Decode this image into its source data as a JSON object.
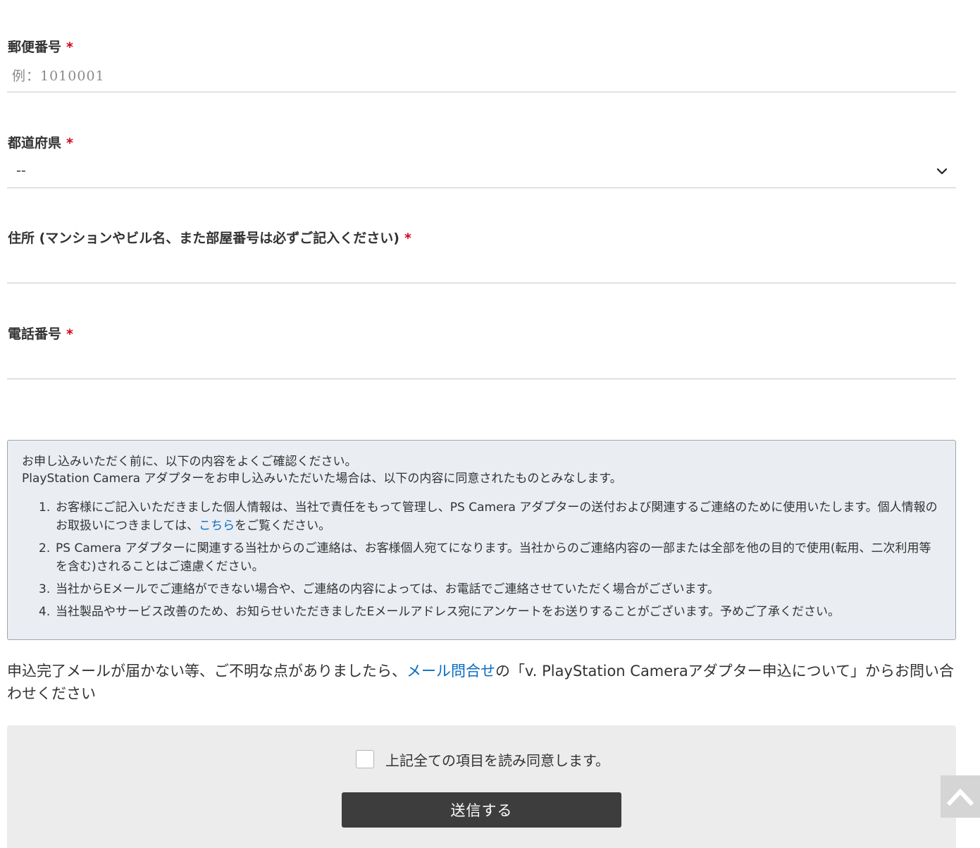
{
  "form": {
    "postal": {
      "label": "郵便番号",
      "required_mark": "*",
      "placeholder": "例：1010001",
      "value": ""
    },
    "prefecture": {
      "label": "都道府県",
      "required_mark": "*",
      "selected": "--"
    },
    "address": {
      "label": "住所 (マンションやビル名、また部屋番号は必ずご記入ください)",
      "required_mark": "*",
      "value": ""
    },
    "phone": {
      "label": "電話番号",
      "required_mark": "*",
      "value": ""
    }
  },
  "notice": {
    "intro_line1": "お申し込みいただく前に、以下の内容をよくご確認ください。",
    "intro_line2": "PlayStation Camera アダプターをお申し込みいただいた場合は、以下の内容に同意されたものとみなします。",
    "items": [
      {
        "num": "1.",
        "text_before": "お客様にご記入いただきました個人情報は、当社で責任をもって管理し、PS Camera アダプターの送付および関連するご連絡のために使用いたします。個人情報のお取扱いにつきましては、",
        "link": "こちら",
        "text_after": "をご覧ください。"
      },
      {
        "num": "2.",
        "text": "PS Camera アダプターに関連する当社からのご連絡は、お客様個人宛てになります。当社からのご連絡内容の一部または全部を他の目的で使用(転用、二次利用等を含む)されることはご遠慮ください。"
      },
      {
        "num": "3.",
        "text": "当社からEメールでご連絡ができない場合や、ご連絡の内容によっては、お電話でご連絡させていただく場合がございます。"
      },
      {
        "num": "4.",
        "text": "当社製品やサービス改善のため、お知らせいただきましたEメールアドレス宛にアンケートをお送りすることがございます。予めご了承ください。"
      }
    ]
  },
  "contact": {
    "text_before": "申込完了メールが届かない等、ご不明な点がありましたら、",
    "link": "メール問合せ",
    "text_after": "の「v. PlayStation Cameraアダプター申込について」からお問い合わせください"
  },
  "agreement": {
    "checkbox_label": "上記全ての項目を読み同意します。",
    "checked": false,
    "submit_label": "送信する"
  },
  "icons": {
    "chevron": "chevron-down-icon",
    "back_to_top": "chevron-up-icon"
  },
  "colors": {
    "required": "#d0021b",
    "link": "#0a6cbf",
    "notice_bg": "#eaeef3",
    "submit_bg": "#3d3d3d"
  }
}
